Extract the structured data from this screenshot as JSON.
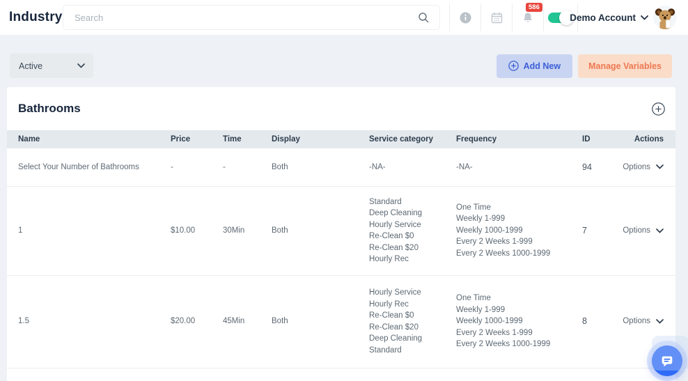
{
  "header": {
    "title": "Industry",
    "search": {
      "placeholder": "Search",
      "value": ""
    },
    "notification_badge": "586",
    "toggle_state": "on",
    "account": {
      "label": "Demo Account"
    }
  },
  "toolbar": {
    "filter": {
      "value": "Active"
    },
    "add_new_label": "Add New",
    "manage_variables_label": "Manage Variables"
  },
  "card": {
    "title": "Bathrooms"
  },
  "table": {
    "columns": [
      "Name",
      "Price",
      "Time",
      "Display",
      "Service category",
      "Frequency",
      "ID",
      "Actions"
    ],
    "options_label": "Options",
    "rows": [
      {
        "name": "Select Your Number of Bathrooms",
        "price": "-",
        "time": "-",
        "display": "Both",
        "service_category": [
          "-NA-"
        ],
        "frequency": [
          "-NA-"
        ],
        "id": "94"
      },
      {
        "name": "1",
        "price": "$10.00",
        "time": "30Min",
        "display": "Both",
        "service_category": [
          "Standard",
          "Deep Cleaning",
          "Hourly Service",
          "Re-Clean $0",
          "Re-Clean $20",
          "Hourly Rec"
        ],
        "frequency": [
          "One Time",
          "Weekly 1-999",
          "Weekly 1000-1999",
          "Every 2 Weeks 1-999",
          "Every 2 Weeks 1000-1999"
        ],
        "id": "7"
      },
      {
        "name": "1.5",
        "price": "$20.00",
        "time": "45Min",
        "display": "Both",
        "service_category": [
          "Hourly Service",
          "Hourly Rec",
          "Re-Clean $0",
          "Re-Clean $20",
          "Deep Cleaning",
          "Standard"
        ],
        "frequency": [
          "One Time",
          "Weekly 1-999",
          "Weekly 1000-1999",
          "Every 2 Weeks 1-999",
          "Every 2 Weeks 1000-1999"
        ],
        "id": "8"
      }
    ]
  },
  "icons": {
    "search": "magnifier",
    "info": "i-circle",
    "calendar": "calendar-grid",
    "bell": "notification-bell",
    "chevron_down": "v",
    "circle_plus": "plus-in-circle",
    "chat": "speech-bubble",
    "avatar": "koala-mascot"
  },
  "colors": {
    "page_bg": "#eef1f5",
    "topbar_bg": "#ffffff",
    "navy_text": "#17263c",
    "table_header_bg": "#e4e9ed",
    "cell_text": "#5d6973",
    "add_new_bg": "#c8d4f2",
    "add_new_text": "#3b5ed7",
    "manage_bg": "#fadcc9",
    "manage_text": "#ee7850",
    "toggle_green": "#22c493",
    "badge_red": "#e8463d",
    "chat_blue": "#2f6bf6"
  }
}
